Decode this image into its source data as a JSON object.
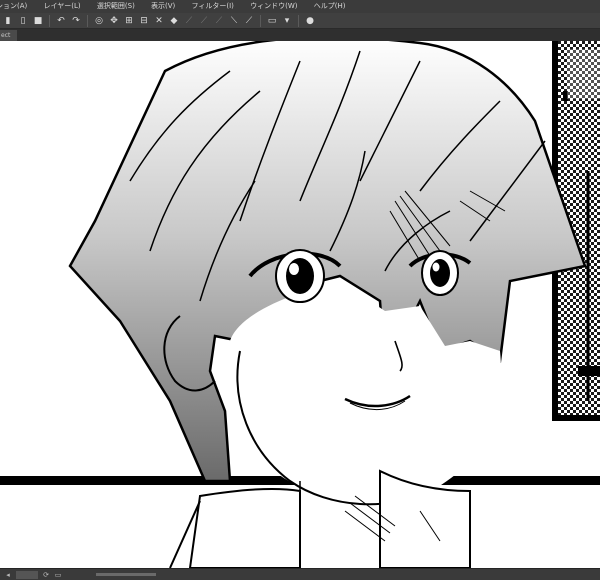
{
  "menu": {
    "items": [
      "ション(A)",
      "レイヤー(L)",
      "選択範囲(S)",
      "表示(V)",
      "フィルター(I)",
      "ウィンドウ(W)",
      "ヘルプ(H)"
    ]
  },
  "toolbar": {
    "icons": [
      "new-icon",
      "open-icon",
      "save-icon",
      "undo-icon",
      "redo-icon",
      "clear-icon",
      "transform-icon",
      "select-all-icon",
      "deselect-icon",
      "invert-selection-icon",
      "fill-icon",
      "ruler-icon",
      "snap-icon",
      "pen-icon",
      "brush-icon",
      "screen-icon",
      "info-icon"
    ]
  },
  "tab": {
    "label": "ect"
  },
  "status": {
    "zoom": ""
  },
  "colors": {
    "chrome_dark": "#3b3b3b",
    "toolbar": "#404040",
    "ink": "#000000",
    "paper": "#ffffff"
  }
}
